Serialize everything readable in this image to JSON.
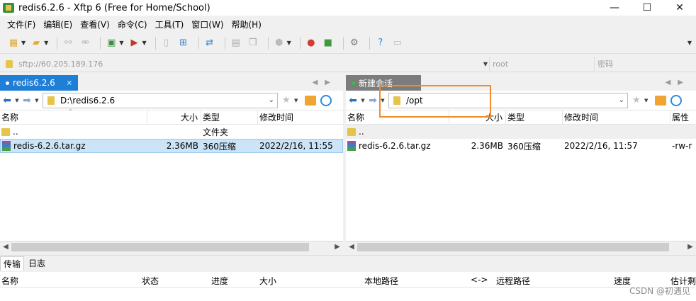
{
  "window": {
    "title": "redis6.2.6 - Xftp 6 (Free for Home/School)",
    "minimize": "—",
    "maximize": "☐",
    "close": "✕"
  },
  "menu": [
    "文件(F)",
    "编辑(E)",
    "查看(V)",
    "命令(C)",
    "工具(T)",
    "窗口(W)",
    "帮助(H)"
  ],
  "address": {
    "host": "sftp://60.205.189.176",
    "user_placeholder": "root",
    "password_placeholder": "密码"
  },
  "left_pane": {
    "tab_label": "redis6.2.6",
    "tab_close": "×",
    "path": "D:\\redis6.2.6",
    "columns": [
      "名称",
      "大小",
      "类型",
      "修改时间"
    ],
    "parent_row": {
      "name": "..",
      "type": "文件夹"
    },
    "files": [
      {
        "name": "redis-6.2.6.tar.gz",
        "size": "2.36MB",
        "type": "360压缩",
        "modified": "2022/2/16, 11:55"
      }
    ]
  },
  "right_pane": {
    "tab_label": "新建会话",
    "path": "/opt",
    "columns": [
      "名称",
      "大小",
      "类型",
      "修改时间",
      "属性"
    ],
    "parent_row": {
      "name": ".."
    },
    "files": [
      {
        "name": "redis-6.2.6.tar.gz",
        "size": "2.36MB",
        "type": "360压缩",
        "modified": "2022/2/16, 11:57",
        "attr": "-rw-r"
      }
    ]
  },
  "bottom": {
    "tabs": [
      "传输",
      "日志"
    ],
    "columns": [
      "名称",
      "状态",
      "进度",
      "大小",
      "本地路径",
      "<->",
      "远程路径",
      "速度",
      "估计剩"
    ]
  },
  "watermark": "CSDN @初遇见",
  "colors": {
    "tab_active": "#1f7fd6",
    "tab_inactive": "#7c7c7c",
    "annotation": "#f08b2f",
    "selection": "#cce4f7"
  }
}
